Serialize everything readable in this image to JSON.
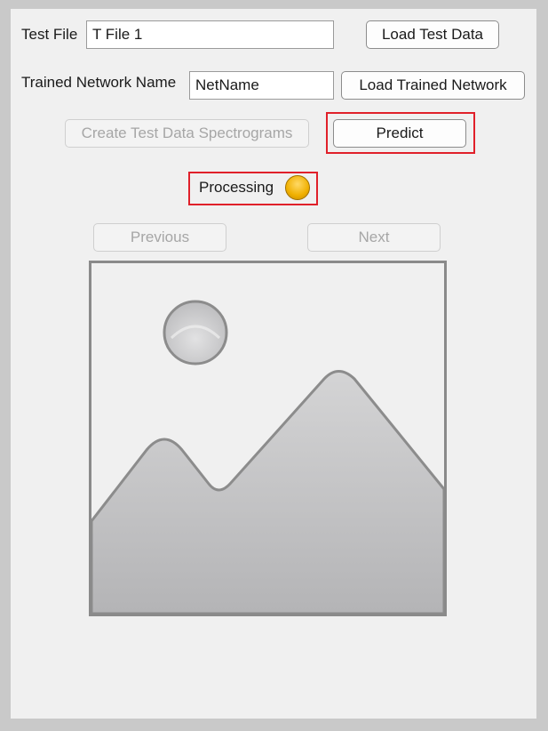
{
  "test_file": {
    "label": "Test File",
    "value": "T File 1"
  },
  "load_test_data_button": "Load Test Data",
  "trained_network": {
    "label": "Trained Network Name",
    "value": "NetName"
  },
  "load_trained_network_button": "Load Trained Network",
  "create_spectrograms_button": "Create Test Data Spectrograms",
  "predict_button": "Predict",
  "processing": {
    "label": "Processing",
    "lamp_color": "#f0b000"
  },
  "previous_button": "Previous",
  "next_button": "Next",
  "image_placeholder": {
    "icon": "image-placeholder-icon"
  },
  "colors": {
    "highlight": "#e0202a",
    "panel": "#f0f0f0",
    "frame": "#c9c9c9"
  }
}
